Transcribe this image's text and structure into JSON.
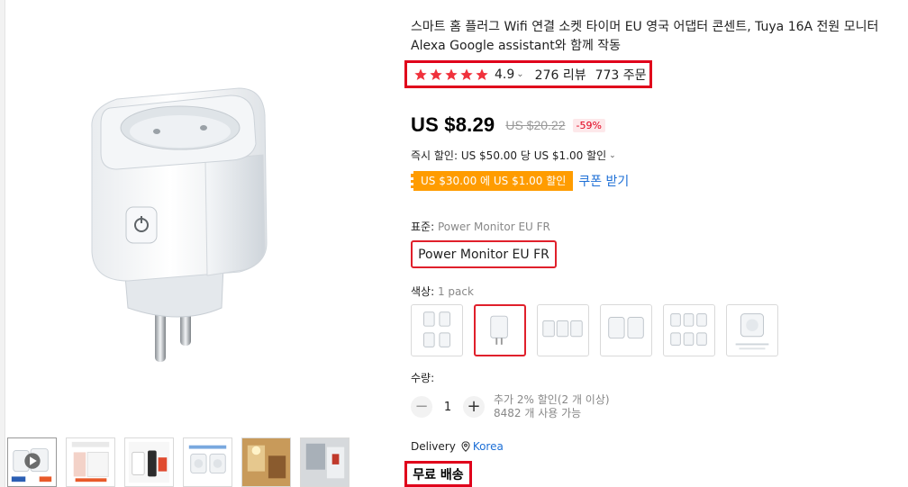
{
  "product": {
    "title": "스마트 홈 플러그 Wifi 연결 소켓 타이머 EU 영국 어댑터 콘센트, Tuya 16A 전원 모니터 Alexa Google assistant와 함께 작동",
    "rating_value": "4.9",
    "reviews": "276 리뷰",
    "orders": "773 주문",
    "star_color": "#f0313c"
  },
  "pricing": {
    "price": "US $8.29",
    "old_price": "US $20.22",
    "discount": "-59%",
    "instant_discount": "즉시 할인: US $50.00 당 US $1.00 할인",
    "coupon_tag": "US $30.00 에 US $1.00 할인",
    "coupon_link": "쿠폰 받기"
  },
  "options": {
    "standard_label": "표준: ",
    "standard_value": "Power Monitor EU FR",
    "standard_button": "Power Monitor EU FR",
    "color_label": "색상: ",
    "color_value": "1 pack",
    "swatches": [
      "4 pack",
      "1 pack",
      "3 pack",
      "2 pack",
      "6 pack",
      "1 pack box"
    ]
  },
  "quantity": {
    "label": "수량:",
    "value": "1",
    "minus": "−",
    "plus": "+",
    "note_line1": "추가 2% 할인(2 개 이상)",
    "note_line2": "8482 개 사용 가능"
  },
  "delivery": {
    "label": "Delivery",
    "country": "Korea",
    "free_shipping": "무료 배송"
  },
  "colors": {
    "accent_red": "#e0001b",
    "coupon_orange": "#ff9c00",
    "link_blue": "#1d6fd6"
  }
}
